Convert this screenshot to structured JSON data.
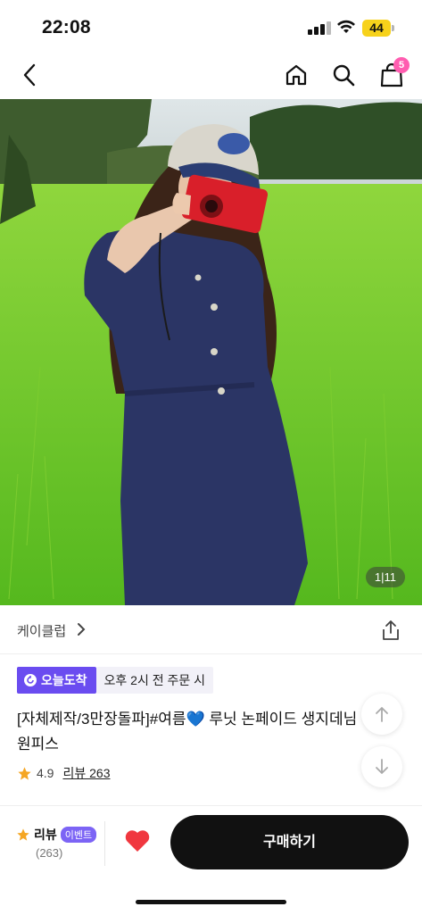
{
  "status": {
    "time": "22:08",
    "battery": "44"
  },
  "nav": {
    "cart_count": "5"
  },
  "hero": {
    "image_counter": "1|11"
  },
  "store": {
    "name": "케이클럽"
  },
  "badges": {
    "today_label": "오늘도착",
    "order_info": "오후 2시 전 주문 시"
  },
  "product": {
    "title_part1": "[자체제작/3만장돌파]#여름",
    "title_emoji": "💙",
    "title_part2": " 루닛 논페이드 생지데님",
    "title_line2": "원피스",
    "rating": "4.9",
    "review_link": "리뷰 263"
  },
  "bottom_bar": {
    "review_label": "리뷰",
    "event_badge": "이벤트",
    "review_count": "(263)",
    "buy_label": "구매하기"
  },
  "colors": {
    "accent": "#6a4cf0",
    "badge": "#ff5db0",
    "like": "#f0373f"
  }
}
